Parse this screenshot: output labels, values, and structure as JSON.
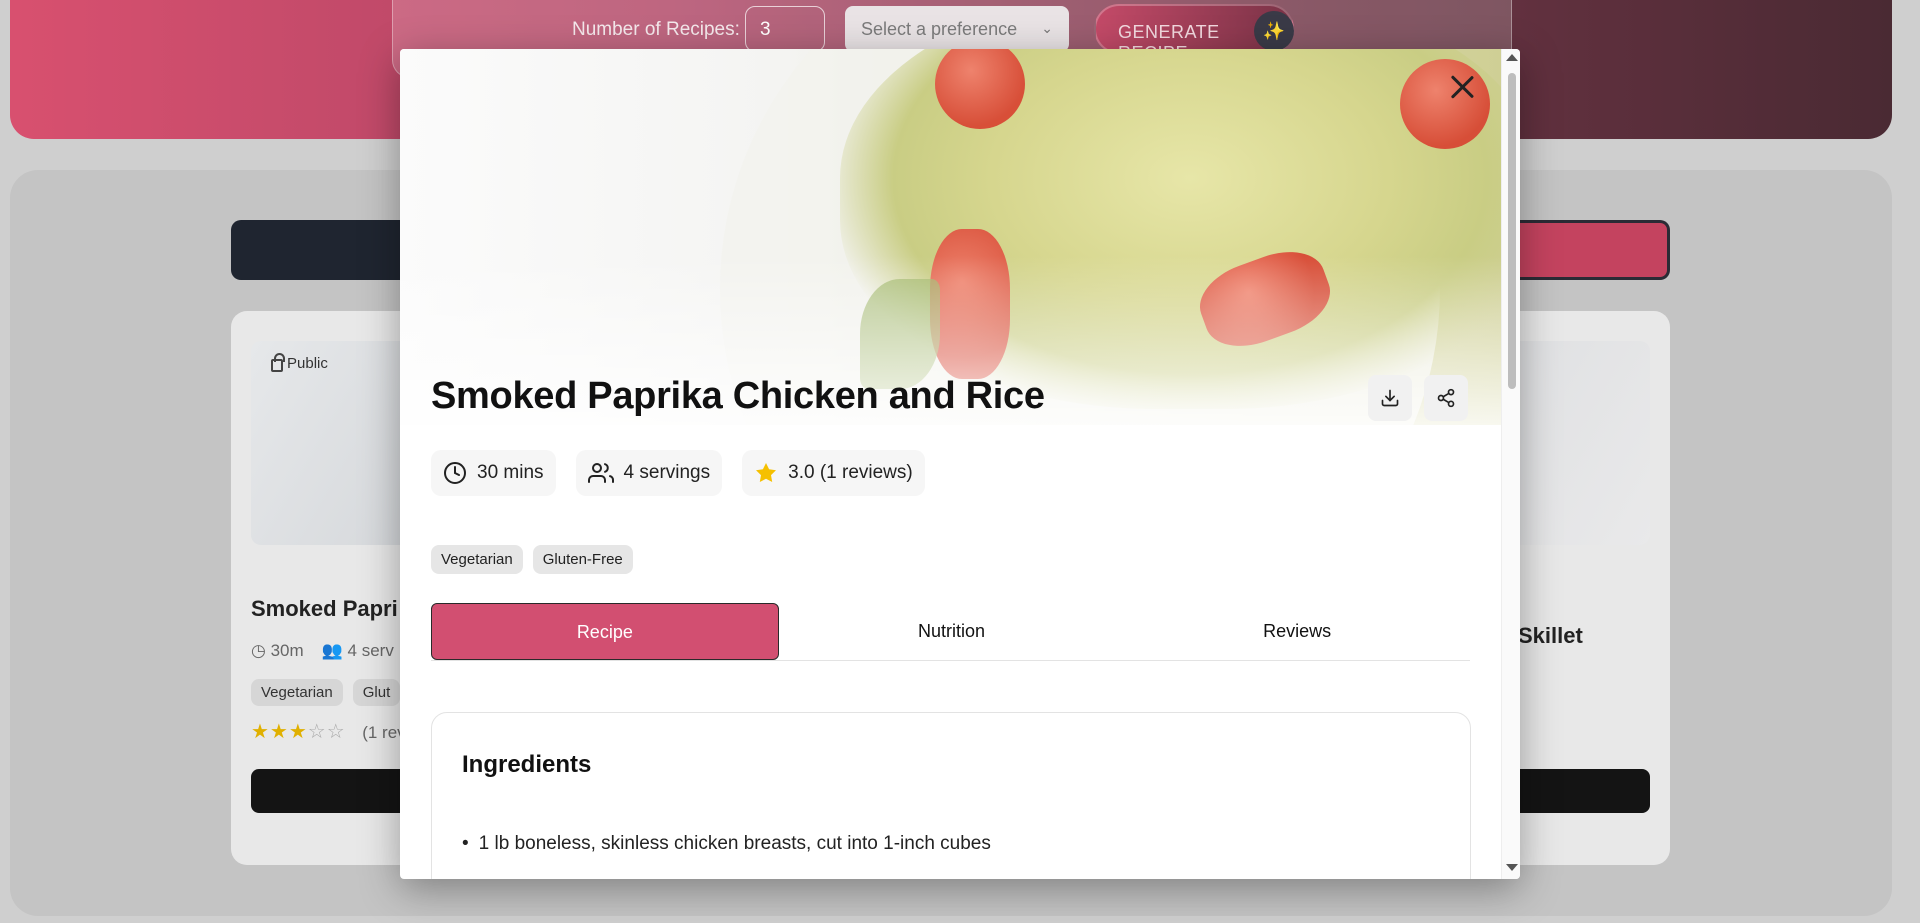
{
  "generator": {
    "count_label": "Number of Recipes:",
    "count_value": "3",
    "preference_placeholder": "Select a preference",
    "generate_label": "GENERATE RECIPE"
  },
  "background_cards": [
    {
      "visibility": "Public",
      "title": "Smoked Papri",
      "time": "30m",
      "servings": "4 serv",
      "tags": [
        "Vegetarian",
        "Glut"
      ],
      "rating_filled": 3,
      "rating_max": 5,
      "reviews": "(1 rev"
    },
    {
      "title": "Skillet"
    }
  ],
  "modal": {
    "title": "Smoked Paprika Chicken and Rice",
    "stats": {
      "time": "30 mins",
      "servings": "4 servings",
      "rating": "3.0 (1 reviews)"
    },
    "tags": [
      "Vegetarian",
      "Gluten-Free"
    ],
    "tabs": [
      {
        "label": "Recipe",
        "active": true
      },
      {
        "label": "Nutrition",
        "active": false
      },
      {
        "label": "Reviews",
        "active": false
      }
    ],
    "ingredients": {
      "heading": "Ingredients",
      "items": [
        "1 lb boneless, skinless chicken breasts, cut into 1-inch cubes"
      ]
    }
  },
  "colors": {
    "accent": "#d24f71",
    "star": "#f5c000"
  },
  "icons": {
    "close": "close-icon",
    "download": "download-icon",
    "share": "share-icon",
    "clock": "clock-icon",
    "users": "users-icon",
    "star": "star-icon",
    "sparkle": "sparkle-icon",
    "lock": "lock-icon"
  }
}
